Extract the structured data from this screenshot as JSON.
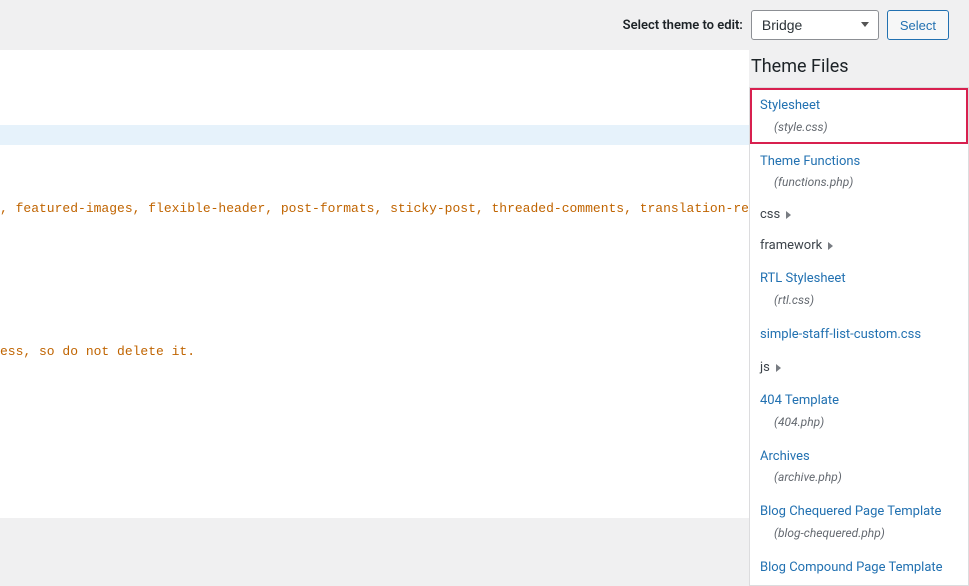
{
  "header": {
    "select_label": "Select theme to edit:",
    "selected_theme": "Bridge",
    "select_button": "Select"
  },
  "sidebar": {
    "title": "Theme Files",
    "items": [
      {
        "name": "Stylesheet",
        "file": "(style.css)",
        "highlighted": true,
        "link": true
      },
      {
        "name": "Theme Functions",
        "file": "(functions.php)",
        "link": true
      },
      {
        "name": "css",
        "folder": true
      },
      {
        "name": "framework",
        "folder": true
      },
      {
        "name": "RTL Stylesheet",
        "file": "(rtl.css)",
        "link": true
      },
      {
        "name": "simple-staff-list-custom.css",
        "link": true
      },
      {
        "name": "js",
        "folder": true
      },
      {
        "name": "404 Template",
        "file": "(404.php)",
        "link": true
      },
      {
        "name": "Archives",
        "file": "(archive.php)",
        "link": true
      },
      {
        "name": "Blog Chequered Page Template",
        "file": "(blog-chequered.php)",
        "link": true
      },
      {
        "name": "Blog Compound Page Template",
        "link": true
      }
    ]
  },
  "editor": {
    "line1": ", featured-images, flexible-header, post-formats, sticky-post, threaded-comments, translation-ready",
    "line2": "ess, so do not delete it."
  }
}
